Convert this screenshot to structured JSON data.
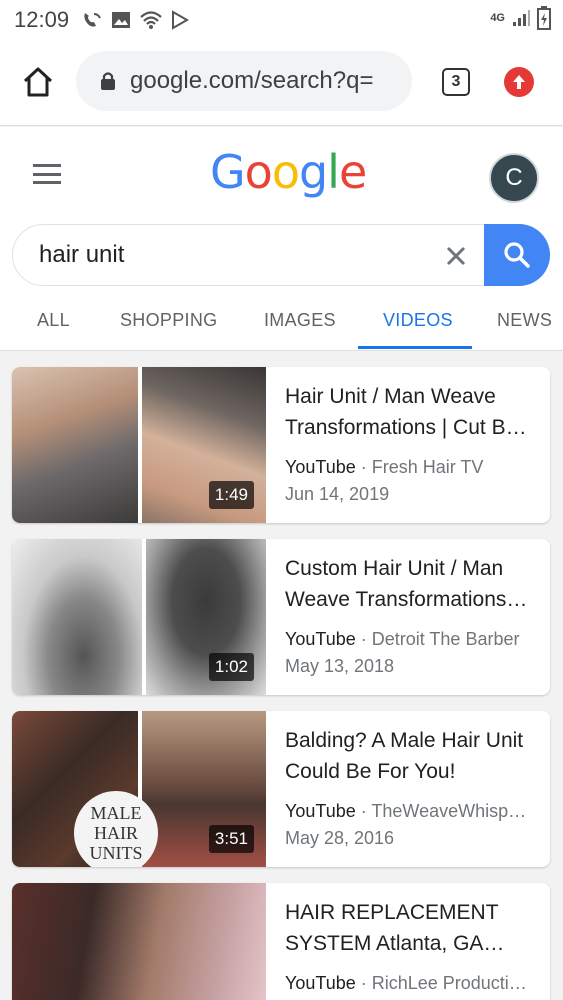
{
  "status_bar": {
    "time": "12:09",
    "network": "4G"
  },
  "browser": {
    "url": "google.com/search?q=",
    "tab_count": "3"
  },
  "google": {
    "logo": [
      "G",
      "o",
      "o",
      "g",
      "l",
      "e"
    ],
    "avatar_letter": "C"
  },
  "search": {
    "query": "hair unit"
  },
  "tabs": [
    {
      "label": "ALL"
    },
    {
      "label": "SHOPPING"
    },
    {
      "label": "IMAGES"
    },
    {
      "label": "VIDEOS",
      "active": true
    },
    {
      "label": "NEWS"
    }
  ],
  "results": [
    {
      "title_l1": "Hair Unit / Man Weave",
      "title_l2": "Transformations | Cut B…",
      "source": "YouTube",
      "channel": "Fresh Hair TV",
      "date": "Jun 14, 2019",
      "duration": "1:49"
    },
    {
      "title_l1": "Custom Hair Unit / Man",
      "title_l2": "Weave Transformations…",
      "source": "YouTube",
      "channel": "Detroit The Barber",
      "date": "May 13, 2018",
      "duration": "1:02"
    },
    {
      "title_l1": "Balding? A Male Hair Unit",
      "title_l2": "Could Be For You!",
      "source": "YouTube",
      "channel": "TheWeaveWhisp…",
      "date": "May 28, 2016",
      "duration": "3:51",
      "thumb_text": [
        "MALE",
        "HAIR",
        "UNITS"
      ]
    },
    {
      "title_l1": "HAIR REPLACEMENT",
      "title_l2": "SYSTEM Atlanta, GA…",
      "source": "YouTube",
      "channel": "RichLee Producti…",
      "date": "",
      "duration": ""
    }
  ],
  "colors": {
    "accent": "#1a73e8",
    "search_button": "#4285f4",
    "update_badge": "#e53935"
  }
}
